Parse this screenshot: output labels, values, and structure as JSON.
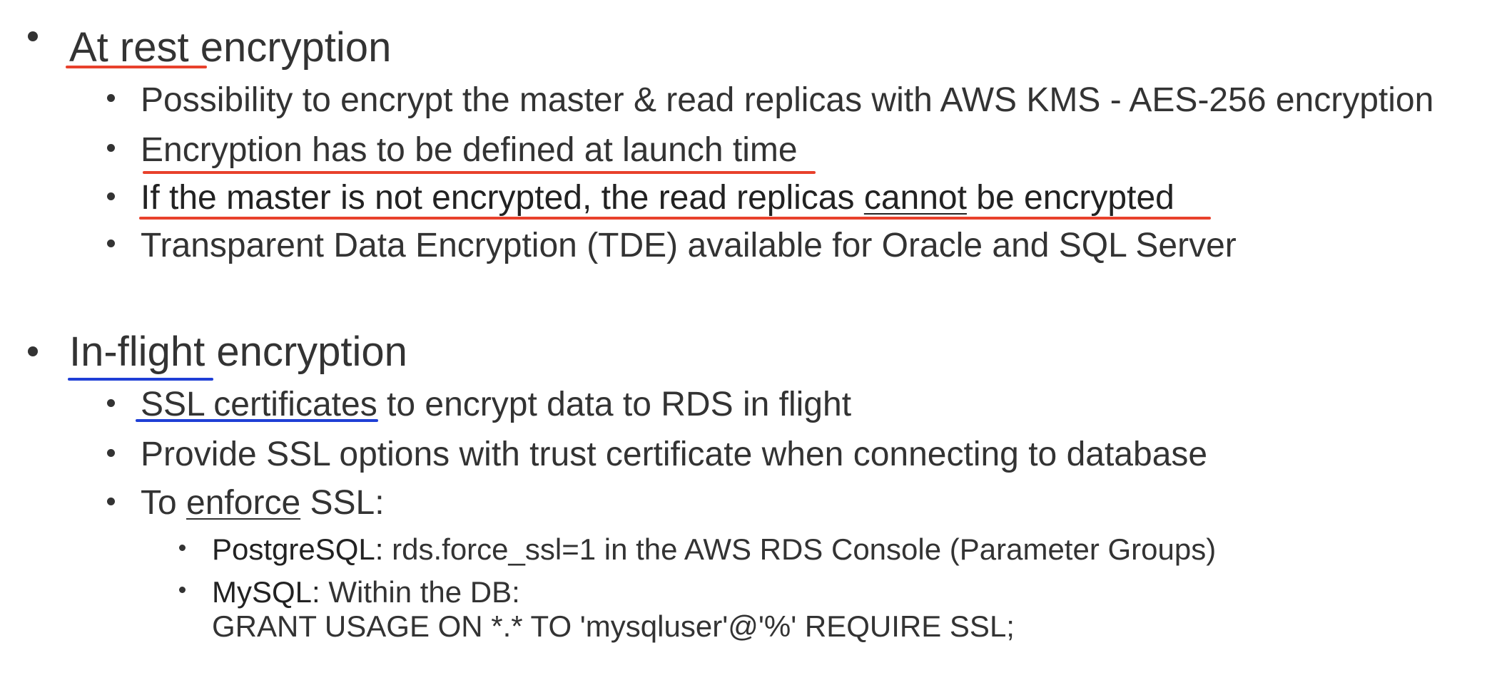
{
  "sections": [
    {
      "heading_marked": "At rest",
      "heading_rest": " encryption",
      "items": [
        "Possibility to encrypt the master & read replicas with AWS KMS - AES-256 encryption",
        "Encryption has to be defined at launch time",
        {
          "before": "If the master is not encrypted, the read replicas ",
          "underlined": "cannot",
          "after": " be encrypted"
        },
        "Transparent Data Encryption (TDE) available for Oracle and SQL Server"
      ]
    },
    {
      "heading_marked": "In-flight",
      "heading_rest": " encryption",
      "items": [
        {
          "marked": "SSL certificates",
          "rest": " to encrypt data to RDS in flight"
        },
        "Provide SSL options with trust certificate when connecting to database",
        {
          "before": "To ",
          "underlined": "enforce",
          "after": " SSL:"
        }
      ],
      "subitems": [
        {
          "label": "PostgreSQL:",
          "text": "  rds.force_ssl=1  in the AWS RDS Console (Parameter Groups)"
        },
        {
          "label": "MySQL:",
          "text": " Within the DB:",
          "line2": "GRANT USAGE ON *.* TO 'mysqluser'@'%' REQUIRE SSL;"
        }
      ]
    }
  ],
  "colors": {
    "text": "#333333",
    "red_marker": "#e8412c",
    "blue_marker": "#1f3fd6"
  }
}
